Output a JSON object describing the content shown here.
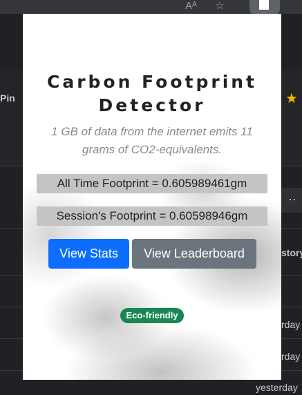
{
  "browser": {
    "read_aloud_icon": "Aᴬ",
    "favorites_icon": "☆",
    "extension_icon": "extension-icon"
  },
  "background_page": {
    "pin_label": "Pin",
    "history_label": "story",
    "more_dots": "··",
    "rows": [
      "rday",
      "rday",
      "yesterday"
    ]
  },
  "popup": {
    "title": "Carbon Footprint Detector",
    "subtitle": "1 GB of data from the internet emits 11 grams of CO2-equivalents.",
    "all_time_footprint": "All Time Footprint = 0.605989461gm",
    "session_footprint": "Session's Footprint = 0.60598946gm",
    "view_stats_label": "View Stats",
    "view_leaderboard_label": "View Leaderboard",
    "badge_label": "Eco-friendly"
  },
  "colors": {
    "primary": "#0d6efd",
    "secondary": "#6c757d",
    "success": "#198754",
    "star": "#f4b400"
  }
}
